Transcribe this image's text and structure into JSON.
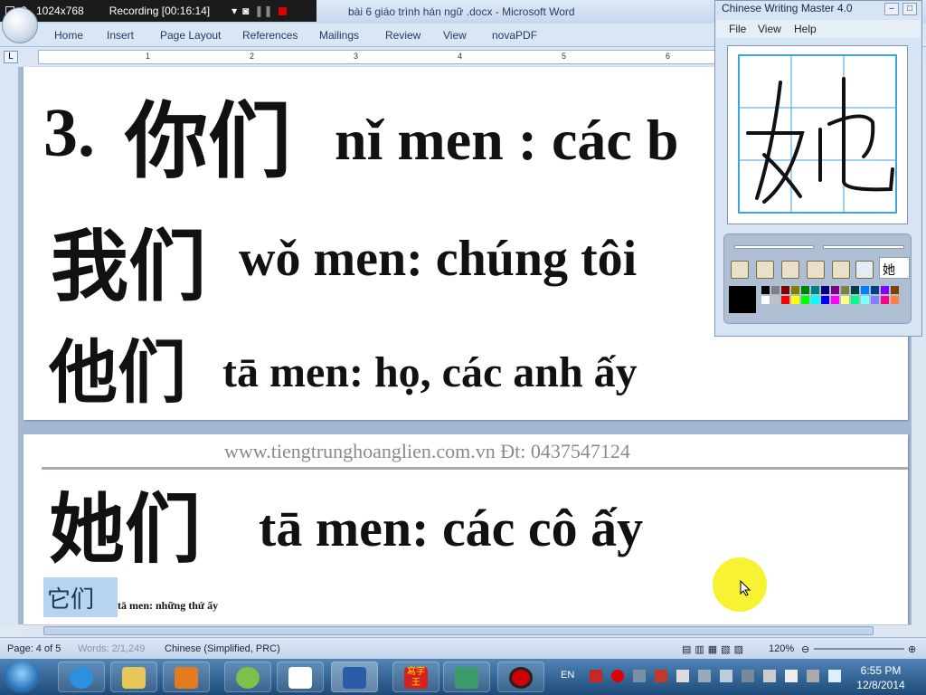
{
  "recorder": {
    "resolution": "1024x768",
    "status": "Recording [00:16:14]"
  },
  "word": {
    "title": "bài 6 giáo trình hán ngữ .docx - Microsoft Word",
    "tabs": [
      "Home",
      "Insert",
      "Page Layout",
      "References",
      "Mailings",
      "Review",
      "View",
      "novaPDF"
    ],
    "ruler_numbers": [
      "1",
      "2",
      "3",
      "4",
      "5",
      "6"
    ]
  },
  "page1": {
    "line1_num": "3.",
    "line1_han": "你们",
    "line1_text": "nǐ men : các b",
    "line2_han": "我们",
    "line2_text": "wǒ men: chúng tôi",
    "line3_han": "他们",
    "line3_text": "tā men: họ, các anh ấy"
  },
  "page2": {
    "website": "www.tiengtrunghoanglien.com.vn Đt: 0437547124",
    "line1_han": "她们",
    "line1_text": "tā men: các cô ấy",
    "line2_han": "它们",
    "line2_text": "tā men: những thứ ấy"
  },
  "status": {
    "page": "Page: 4 of 5",
    "words": "Words: 2/1,249",
    "language": "Chinese (Simplified, PRC)",
    "zoom": "120%"
  },
  "taskbar": {
    "lang": "EN",
    "time": "6:55 PM",
    "date": "12/8/2014",
    "app_label": "寫字王"
  },
  "cwm": {
    "title": "Chinese Writing Master 4.0",
    "menu": [
      "File",
      "View",
      "Help"
    ],
    "character": "她"
  }
}
